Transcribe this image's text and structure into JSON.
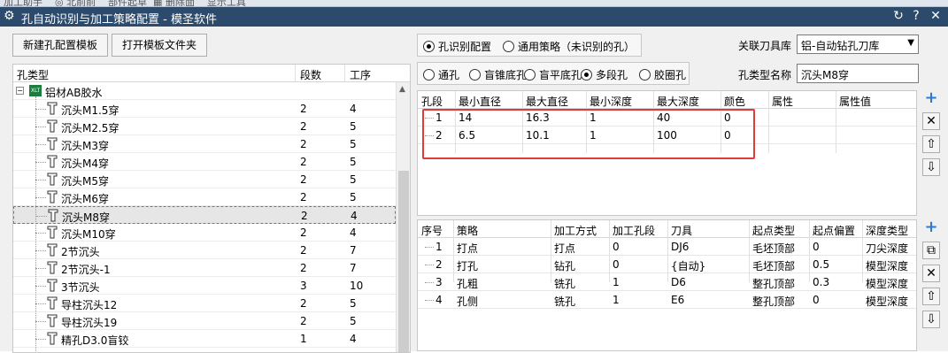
{
  "window": {
    "title": "孔自动识别与加工策略配置 - 模圣软件",
    "top_strip": "加工助手    ◎ 北前前    部件起草  ▦ 删除面    显示工具"
  },
  "toolbar": {
    "new_template": "新建孔配置模板",
    "open_folder": "打开模板文件夹"
  },
  "tree": {
    "headers": [
      "孔类型",
      "段数",
      "工序"
    ],
    "root": "铝材AB胶水",
    "root_badge": "XLT",
    "items": [
      {
        "name": "沉头M1.5穿",
        "segments": "2",
        "steps": "4"
      },
      {
        "name": "沉头M2.5穿",
        "segments": "2",
        "steps": "5"
      },
      {
        "name": "沉头M3穿",
        "segments": "2",
        "steps": "5"
      },
      {
        "name": "沉头M4穿",
        "segments": "2",
        "steps": "5"
      },
      {
        "name": "沉头M5穿",
        "segments": "2",
        "steps": "5"
      },
      {
        "name": "沉头M6穿",
        "segments": "2",
        "steps": "5"
      },
      {
        "name": "沉头M8穿",
        "segments": "2",
        "steps": "4"
      },
      {
        "name": "沉头M10穿",
        "segments": "2",
        "steps": "4"
      },
      {
        "name": "2节沉头",
        "segments": "2",
        "steps": "7"
      },
      {
        "name": "2节沉头-1",
        "segments": "2",
        "steps": "7"
      },
      {
        "name": "3节沉头",
        "segments": "3",
        "steps": "10"
      },
      {
        "name": "导柱沉头12",
        "segments": "2",
        "steps": "5"
      },
      {
        "name": "导柱沉头19",
        "segments": "2",
        "steps": "5"
      },
      {
        "name": "精孔D3.0盲铰",
        "segments": "1",
        "steps": "4"
      }
    ],
    "selected_index": 6
  },
  "config_mode": {
    "options": [
      "孔识别配置",
      "通用策略（未识别的孔）"
    ],
    "selected": 0
  },
  "tool_library": {
    "label": "关联刀具库",
    "value": "铝-自动钻孔刀库"
  },
  "hole_kind": {
    "options": [
      "通孔",
      "盲锥底孔",
      "盲平底孔",
      "多段孔",
      "胶圈孔"
    ],
    "selected": 3
  },
  "hole_type_name": {
    "label": "孔类型名称",
    "value": "沉头M8穿"
  },
  "segment_grid": {
    "headers": [
      "孔段",
      "最小直径",
      "最大直径",
      "最小深度",
      "最大深度",
      "颜色",
      "属性",
      "属性值"
    ],
    "rows": [
      [
        "1",
        "14",
        "16.3",
        "1",
        "40",
        "0",
        "",
        ""
      ],
      [
        "2",
        "6.5",
        "10.1",
        "1",
        "100",
        "0",
        "",
        ""
      ]
    ]
  },
  "strategy_grid": {
    "headers": [
      "序号",
      "策略",
      "加工方式",
      "加工孔段",
      "刀具",
      "起点类型",
      "起点偏置",
      "深度类型"
    ],
    "rows": [
      [
        "1",
        "打点",
        "打点",
        "0",
        "DJ6",
        "毛坯顶部",
        "0",
        "刀尖深度"
      ],
      [
        "2",
        "打孔",
        "钻孔",
        "0",
        "{自动}",
        "毛坯顶部",
        "0.5",
        "模型深度"
      ],
      [
        "3",
        "孔粗",
        "铣孔",
        "1",
        "D6",
        "整孔顶部",
        "0.3",
        "模型深度"
      ],
      [
        "4",
        "孔侧",
        "铣孔",
        "1",
        "E6",
        "整孔顶部",
        "0",
        "模型深度"
      ]
    ]
  },
  "colors": {
    "titlebar": "#2c4a6c",
    "highlight_box": "#e03b3b",
    "add_icon": "#2b7bd4"
  }
}
